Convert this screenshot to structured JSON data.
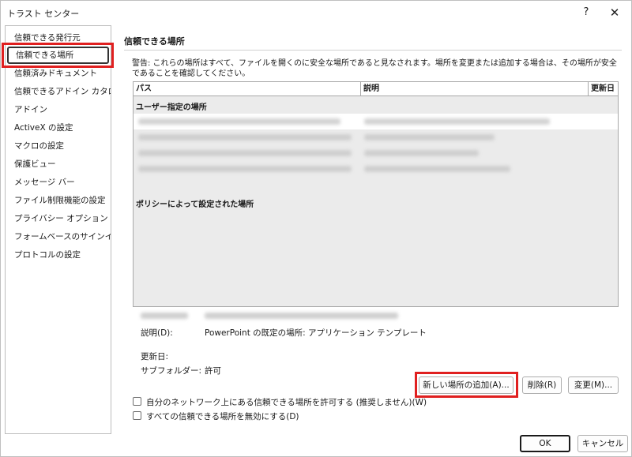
{
  "window": {
    "title": "トラスト センター",
    "help_glyph": "?",
    "close_glyph": "✕"
  },
  "nav": {
    "items": [
      {
        "label": "信頼できる発行元"
      },
      {
        "label": "信頼できる場所"
      },
      {
        "label": "信頼済みドキュメント"
      },
      {
        "label": "信頼できるアドイン カタログ"
      },
      {
        "label": "アドイン"
      },
      {
        "label": "ActiveX の設定"
      },
      {
        "label": "マクロの設定"
      },
      {
        "label": "保護ビュー"
      },
      {
        "label": "メッセージ バー"
      },
      {
        "label": "ファイル制限機能の設定"
      },
      {
        "label": "プライバシー オプション"
      },
      {
        "label": "フォームベースのサインイン"
      },
      {
        "label": "プロトコルの設定"
      }
    ],
    "selected_index": 1
  },
  "main": {
    "section_title": "信頼できる場所",
    "warning": "警告: これらの場所はすべて、ファイルを開くのに安全な場所であると見なされます。場所を変更または追加する場合は、その場所が安全であることを確認してください。",
    "columns": {
      "path": "パス",
      "description": "説明",
      "modified": "更新日"
    },
    "group_user": "ユーザー指定の場所",
    "group_policy": "ポリシーによって設定された場所",
    "details": {
      "description_label": "説明(D):",
      "description_value": "PowerPoint の既定の場所: アプリケーション テンプレート",
      "modified_label": "更新日:",
      "subfolders_label": "サブフォルダー:",
      "subfolders_value": "許可"
    },
    "buttons": {
      "add": "新しい場所の追加(A)...",
      "remove": "削除(R)",
      "modify": "変更(M)..."
    },
    "checkboxes": {
      "allow_network": "自分のネットワーク上にある信頼できる場所を許可する (推奨しません)(W)",
      "disable_all": "すべての信頼できる場所を無効にする(D)"
    }
  },
  "footer": {
    "ok": "OK",
    "cancel": "キャンセル"
  }
}
